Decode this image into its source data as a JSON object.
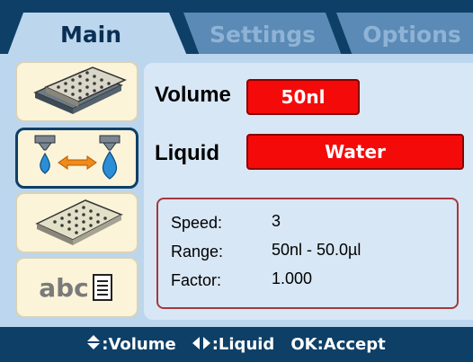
{
  "tabs": [
    {
      "label": "Main",
      "active": true
    },
    {
      "label": "Settings",
      "active": false
    },
    {
      "label": "Options",
      "active": false
    }
  ],
  "sidebar": {
    "items": [
      {
        "icon": "microplate-icon"
      },
      {
        "icon": "dispense-nozzles-icon",
        "active": true
      },
      {
        "icon": "tilted-plate-icon"
      },
      {
        "icon": "abc-label-icon",
        "text": "abc"
      }
    ]
  },
  "fields": {
    "volume": {
      "label": "Volume",
      "value": "50nl"
    },
    "liquid": {
      "label": "Liquid",
      "value": "Water"
    }
  },
  "info": {
    "speed_label": "Speed:",
    "speed_value": "3",
    "range_label": "Range:",
    "range_value": "50nl - 50.0µl",
    "factor_label": "Factor:",
    "factor_value": "1.000"
  },
  "hints": {
    "volume": ":Volume",
    "liquid": ":Liquid",
    "accept": "OK:Accept"
  },
  "colors": {
    "frame": "#0e3f67",
    "panel": "#bcd6ee",
    "content": "#d8e7f5",
    "value_bg": "#f50a0a",
    "button_bg": "#fbf4d9"
  }
}
